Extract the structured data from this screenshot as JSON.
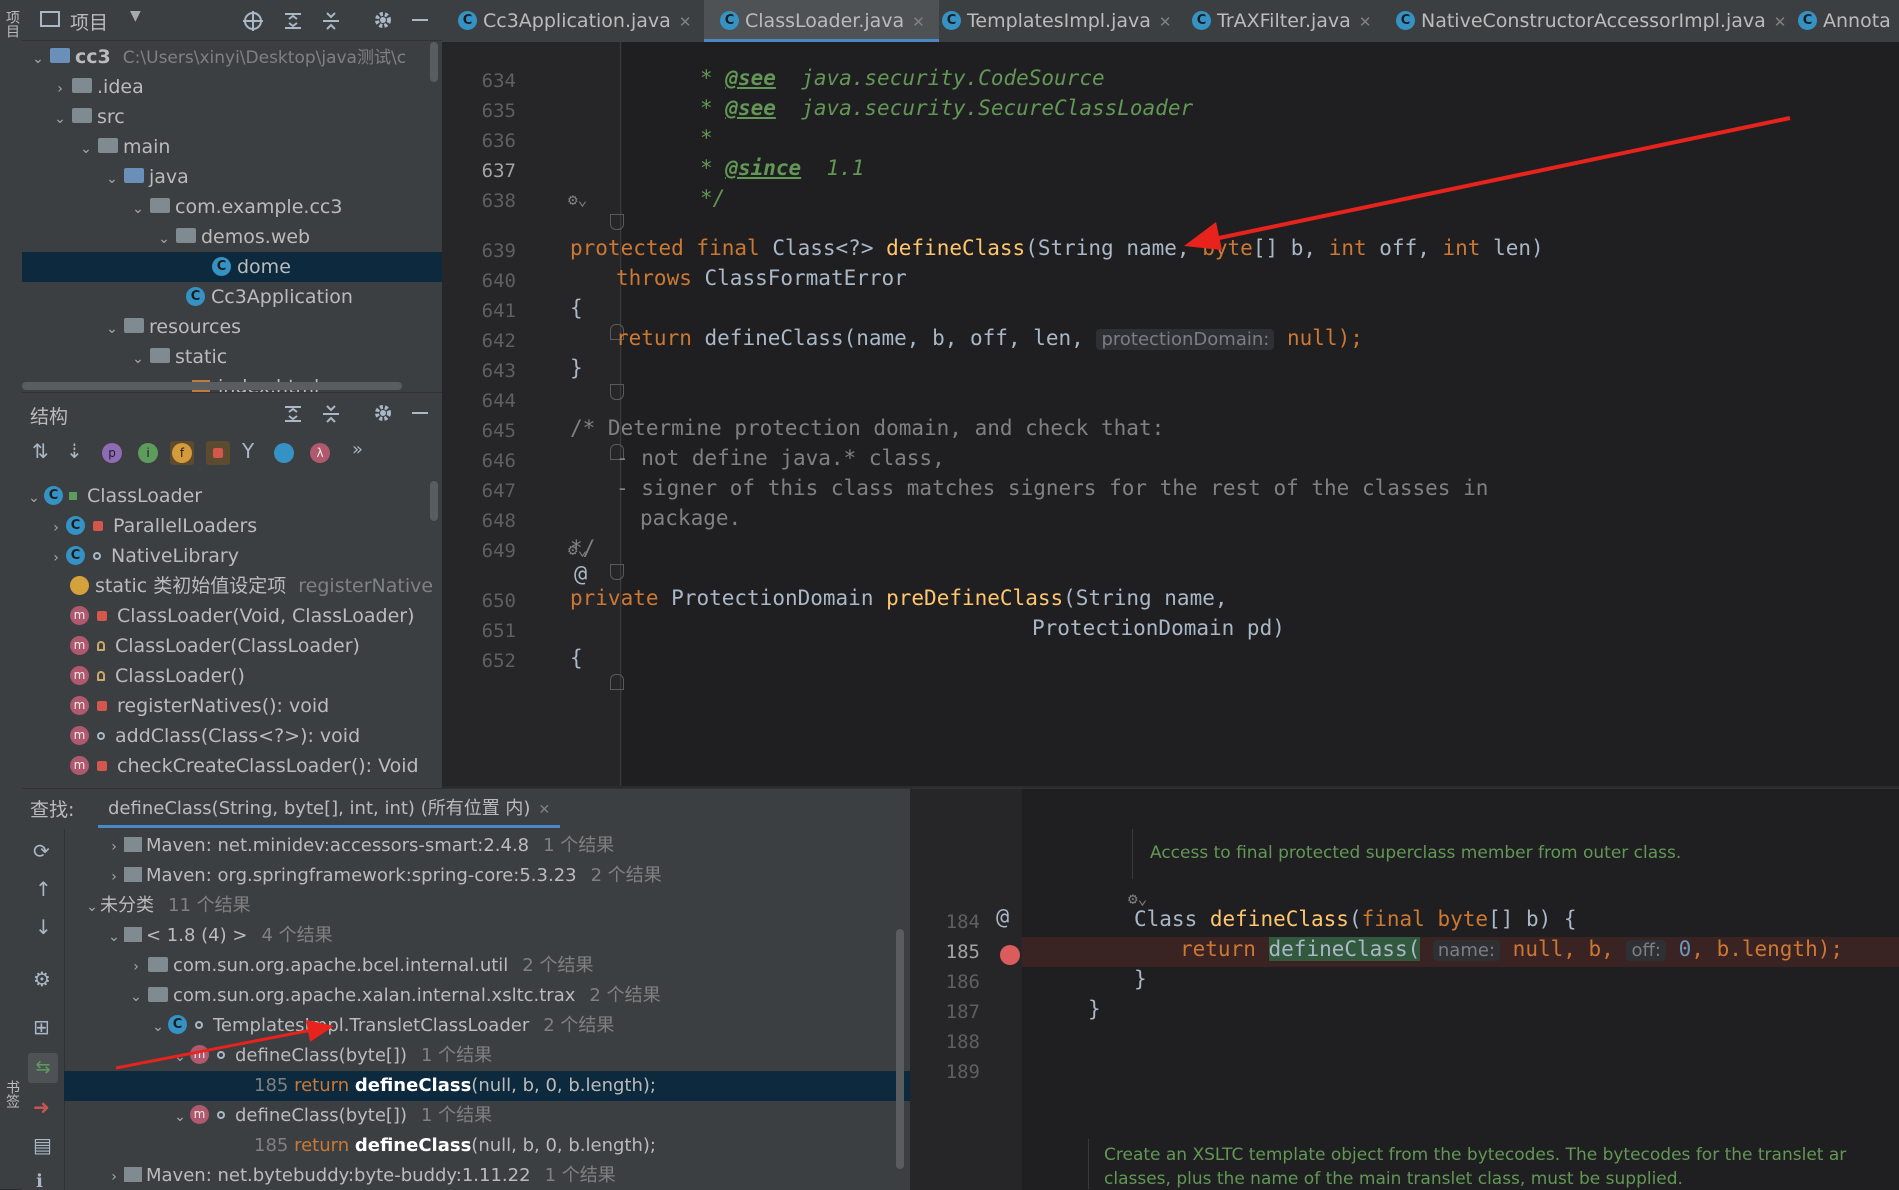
{
  "left_strip": {
    "top_label": "项目",
    "bottom_label": "书签"
  },
  "project_panel": {
    "title": "项目",
    "tree": [
      {
        "label": "cc3",
        "path": "C:\\Users\\xinyi\\Desktop\\java测试\\c"
      },
      {
        "label": ".idea"
      },
      {
        "label": "src"
      },
      {
        "label": "main"
      },
      {
        "label": "java"
      },
      {
        "label": "com.example.cc3"
      },
      {
        "label": "demos.web"
      },
      {
        "label": "dome"
      },
      {
        "label": "Cc3Application"
      },
      {
        "label": "resources"
      },
      {
        "label": "static"
      },
      {
        "label": "index.html"
      }
    ]
  },
  "structure_panel": {
    "title": "结构",
    "items": [
      {
        "label": "ClassLoader"
      },
      {
        "label": "ParallelLoaders"
      },
      {
        "label": "NativeLibrary"
      },
      {
        "label": "static 类初始值设定项",
        "extra": "registerNative"
      },
      {
        "label": "ClassLoader(Void, ClassLoader)"
      },
      {
        "label": "ClassLoader(ClassLoader)"
      },
      {
        "label": "ClassLoader()"
      },
      {
        "label": "registerNatives(): void"
      },
      {
        "label": "addClass(Class<?>): void"
      },
      {
        "label": "checkCreateClassLoader(): Void"
      }
    ]
  },
  "tabs": [
    {
      "label": "Cc3Application.java"
    },
    {
      "label": "ClassLoader.java"
    },
    {
      "label": "TemplatesImpl.java"
    },
    {
      "label": "TrAXFilter.java"
    },
    {
      "label": "NativeConstructorAccessorImpl.java"
    },
    {
      "label": "Annota"
    }
  ],
  "editor": {
    "line_numbers": [
      "634",
      "635",
      "636",
      "637",
      "638",
      "639",
      "640",
      "641",
      "642",
      "643",
      "644",
      "645",
      "646",
      "647",
      "648",
      "649",
      "650",
      "651",
      "652"
    ],
    "code": {
      "l634_tag": "@see",
      "l634_text": "java.security.CodeSource",
      "l635_tag": "@see",
      "l635_text": "java.security.SecureClassLoader",
      "l636": "*",
      "l637_tag": "@since",
      "l637_text": "1.1",
      "l638": "*/",
      "l639_kw": "protected final",
      "l639_type": "Class<?>",
      "l639_fn": "defineClass",
      "l639_open": "(String name,",
      "l639_kw2": "byte",
      "l639_b": "[] b,",
      "l639_kw3": "int",
      "l639_off": "off,",
      "l639_kw4": "int",
      "l639_len": "len)",
      "l640_kw": "throws",
      "l640_text": "ClassFormatError",
      "l641": "{",
      "l642_kw": "return",
      "l642_text": "defineClass(name, b, off, len,",
      "l642_hint": "protectionDomain:",
      "l642_null": "null",
      "l642_end": ");",
      "l643": "}",
      "l645": "/* Determine protection domain, and check that:",
      "l646": "- not define java.* class,",
      "l647": "- signer of this class matches signers for the rest of the classes in",
      "l648": "package.",
      "l649": "*/",
      "l650_kw": "private",
      "l650_type": "ProtectionDomain",
      "l650_fn": "preDefineClass",
      "l650_rest": "(String name,",
      "l651": "ProtectionDomain pd)",
      "l652": "{"
    },
    "gutter_at": "@"
  },
  "find_panel": {
    "label": "查找:",
    "tab": "defineClass(String, byte[], int, int) (所有位置 内)",
    "rows": [
      {
        "text": "Maven: net.minidev:accessors-smart:2.4.8",
        "count": "1 个结果"
      },
      {
        "text": "Maven: org.springframework:spring-core:5.3.23",
        "count": "2 个结果"
      },
      {
        "text": "未分类",
        "count": "11 个结果"
      },
      {
        "text": "< 1.8 (4) >",
        "count": "4 个结果"
      },
      {
        "text": "com.sun.org.apache.bcel.internal.util",
        "count": "2 个结果"
      },
      {
        "text": "com.sun.org.apache.xalan.internal.xsltc.trax",
        "count": "2 个结果"
      },
      {
        "text": "TemplatesImpl.TransletClassLoader",
        "count": "2 个结果"
      },
      {
        "text": "defineClass(byte[])",
        "count": "1 个结果"
      },
      {
        "line": "185",
        "kw": "return",
        "fn": "defineClass",
        "args": "(null, b, 0, b.length);"
      },
      {
        "text": "defineClass(byte[])",
        "count": "1 个结果"
      },
      {
        "line": "185",
        "kw": "return",
        "fn": "defineClass",
        "args": "(null, b, 0, b.length);"
      },
      {
        "text": "Maven: net.bytebuddy:byte-buddy:1.11.22",
        "count": "1 个结果"
      }
    ]
  },
  "preview": {
    "doc_top": "Access to final protected superclass member from outer class.",
    "line_numbers": [
      "184",
      "185",
      "186",
      "187",
      "188",
      "189"
    ],
    "l184_type": "Class",
    "l184_fn": "defineClass",
    "l184_open": "(",
    "l184_kw": "final",
    "l184_kw2": "byte",
    "l184_rest": "[] b) {",
    "l185_kw": "return",
    "l185_fn": "defineClass(",
    "l185_hint1": "name:",
    "l185_null": "null",
    "l185_mid": ", b,",
    "l185_hint2": "off:",
    "l185_zero": "0",
    "l185_end": ", b.length);",
    "l186": "}",
    "l187": "}",
    "doc_bottom1": "Create an XSLTC template object from the bytecodes. The bytecodes for the translet ar",
    "doc_bottom2": "classes, plus the name of the main translet class, must be supplied.",
    "gutter_at": "@"
  },
  "colors": {
    "keyword": "#cc7832",
    "function": "#ffc66d",
    "doc": "#629755",
    "selection": "#0d293e",
    "accent": "#4a88c7",
    "arrow": "#e8231d"
  }
}
